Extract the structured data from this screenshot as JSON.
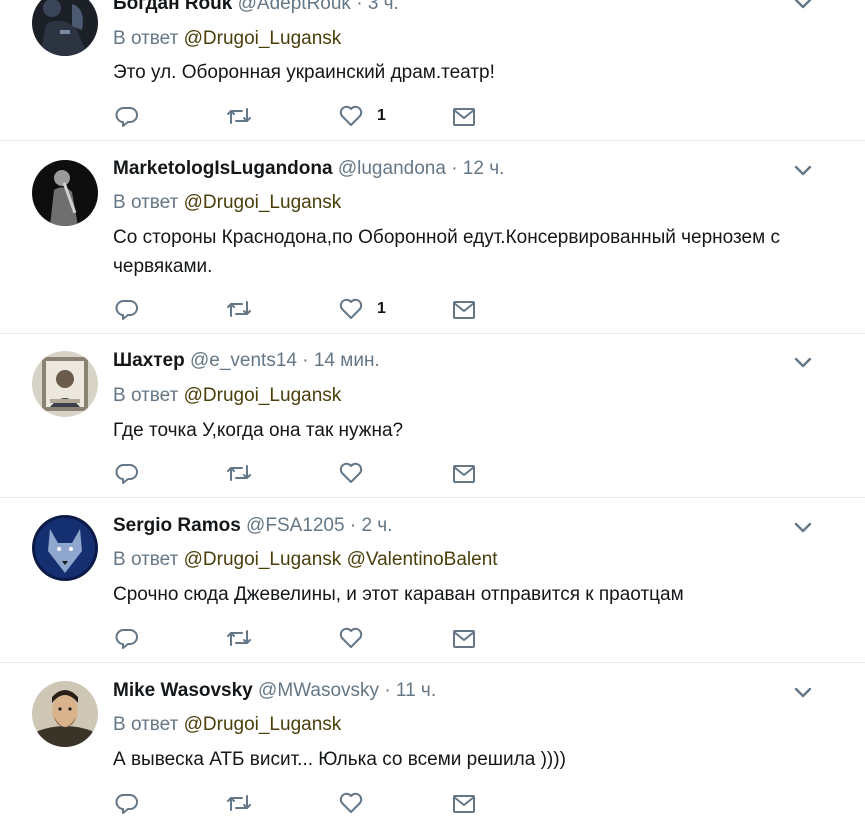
{
  "tweets": [
    {
      "name": "Богдан Rouk",
      "handle": "@AdeptRouk",
      "sep": "·",
      "time": "3 ч.",
      "reply_prefix": "В ответ",
      "mentions": [
        "@Drugoi_Lugansk"
      ],
      "text": "Это ул. Оборонная украинский драм.театр!",
      "likes": "1",
      "avatar_icon": "dark-figure-avatar"
    },
    {
      "name": "MarketologIsLugandona",
      "handle": "@lugandona",
      "sep": "·",
      "time": "12 ч.",
      "reply_prefix": "В ответ",
      "mentions": [
        "@Drugoi_Lugansk"
      ],
      "text": "Со стороны Краснодона,по Оборонной едут.Консервированный чернозем с червяками.",
      "likes": "1",
      "avatar_icon": "soldier-silhouette-avatar"
    },
    {
      "name": "Шахтер",
      "handle": "@e_vents14",
      "sep": "·",
      "time": "14 мин.",
      "reply_prefix": "В ответ",
      "mentions": [
        "@Drugoi_Lugansk"
      ],
      "text": "Где точка У,когда она так нужна?",
      "likes": "",
      "avatar_icon": "portrait-photo-avatar"
    },
    {
      "name": "Sergio Ramos",
      "handle": "@FSA1205",
      "sep": "·",
      "time": "2 ч.",
      "reply_prefix": "В ответ",
      "mentions": [
        "@Drugoi_Lugansk",
        "@ValentinoBalent"
      ],
      "text": "Срочно сюда Джевелины, и этот караван отправится к праотцам",
      "likes": "",
      "avatar_icon": "wolf-avatar"
    },
    {
      "name": "Mike Wasovsky",
      "handle": "@MWasovsky",
      "sep": "·",
      "time": "11 ч.",
      "reply_prefix": "В ответ",
      "mentions": [
        "@Drugoi_Lugansk"
      ],
      "text": "А вывеска АТБ висит... Юлька со всеми решила ))))",
      "likes": "",
      "avatar_icon": "bearded-man-avatar"
    }
  ],
  "icons": {
    "reply": "reply-icon",
    "retweet": "retweet-icon",
    "like": "heart-icon",
    "dm": "envelope-icon",
    "menu": "chevron-down-icon"
  },
  "colors": {
    "text": "#14171a",
    "muted": "#657786",
    "divider": "#e6ecf0",
    "mention": "#4a3f0b"
  }
}
